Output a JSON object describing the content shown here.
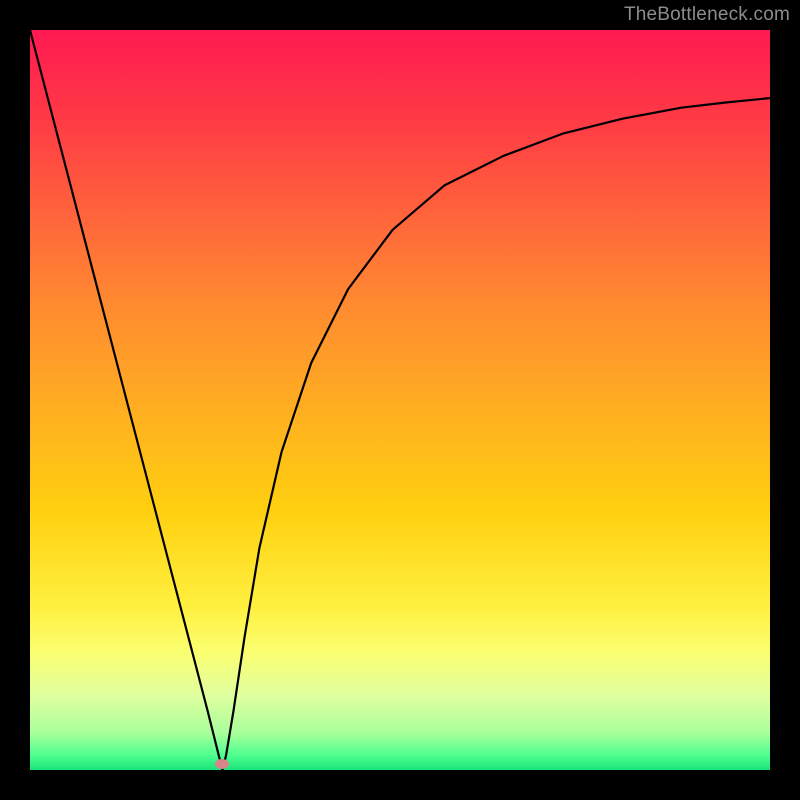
{
  "watermark": "TheBottleneck.com",
  "marker": {
    "x_frac": 0.26,
    "y_frac": 0.992
  },
  "chart_data": {
    "type": "line",
    "title": "",
    "xlabel": "",
    "ylabel": "",
    "xlim": [
      0,
      1
    ],
    "ylim": [
      0,
      1
    ],
    "series": [
      {
        "name": "curve",
        "x": [
          0.0,
          0.03,
          0.06,
          0.09,
          0.12,
          0.15,
          0.18,
          0.21,
          0.24,
          0.255,
          0.26,
          0.265,
          0.275,
          0.29,
          0.31,
          0.34,
          0.38,
          0.43,
          0.49,
          0.56,
          0.64,
          0.72,
          0.8,
          0.88,
          0.94,
          1.0
        ],
        "y": [
          1.0,
          0.885,
          0.77,
          0.655,
          0.54,
          0.425,
          0.31,
          0.195,
          0.08,
          0.02,
          0.0,
          0.02,
          0.08,
          0.18,
          0.3,
          0.43,
          0.55,
          0.65,
          0.73,
          0.79,
          0.83,
          0.86,
          0.88,
          0.895,
          0.902,
          0.908
        ]
      }
    ],
    "marker_point": {
      "x": 0.26,
      "y": 0.0
    }
  }
}
